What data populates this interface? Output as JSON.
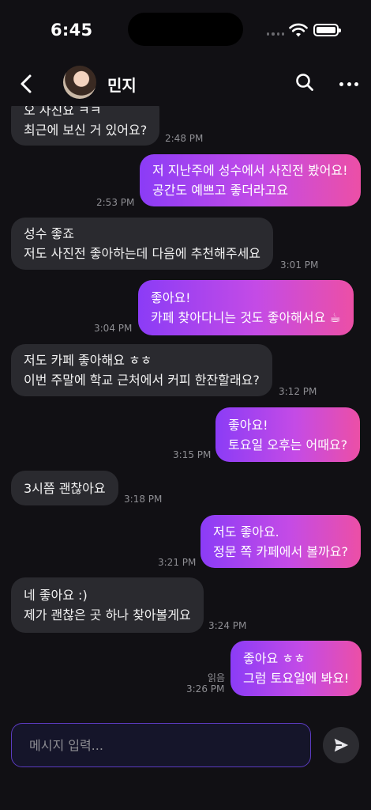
{
  "status_bar": {
    "time": "6:45"
  },
  "header": {
    "contact_name": "민지"
  },
  "messages": [
    {
      "direction": "in",
      "lines": [
        "오 사진요 ㅋㅋ",
        "최근에 보신 거 있어요?"
      ],
      "time": "2:48 PM"
    },
    {
      "direction": "out",
      "lines": [
        "저 지난주에 성수에서 사진전 봤어요!",
        "공간도 예쁘고 좋더라고요"
      ],
      "time": "2:53 PM"
    },
    {
      "direction": "in",
      "lines": [
        "성수 좋죠",
        "저도 사진전 좋아하는데 다음에 추천해주세요"
      ],
      "time": "3:01 PM"
    },
    {
      "direction": "out",
      "lines": [
        "좋아요!",
        "카페 찾아다니는 것도 좋아해서요 ☕"
      ],
      "time": "3:04 PM"
    },
    {
      "direction": "in",
      "lines": [
        "저도 카페 좋아해요 ㅎㅎ",
        "이번 주말에 학교 근처에서 커피 한잔할래요?"
      ],
      "time": "3:12 PM"
    },
    {
      "direction": "out",
      "lines": [
        "좋아요!",
        "토요일 오후는 어때요?"
      ],
      "time": "3:15 PM"
    },
    {
      "direction": "in",
      "lines": [
        "3시쯤 괜찮아요"
      ],
      "time": "3:18 PM"
    },
    {
      "direction": "out",
      "lines": [
        "저도 좋아요.",
        "정문 쪽 카페에서 볼까요?"
      ],
      "time": "3:21 PM"
    },
    {
      "direction": "in",
      "lines": [
        "네 좋아요 :)",
        "제가 괜찮은 곳 하나 찾아볼게요"
      ],
      "time": "3:24 PM"
    },
    {
      "direction": "out",
      "lines": [
        "좋아요 ㅎㅎ",
        "그럼 토요일에 봐요!"
      ],
      "time": "3:26 PM",
      "read_label": "읽음"
    }
  ],
  "composer": {
    "placeholder": "메시지 입력..."
  },
  "icons": {
    "back": "chevron-left-icon",
    "search": "search-icon",
    "more": "more-dots-icon",
    "send": "send-icon",
    "wifi": "wifi-icon",
    "battery": "battery-icon"
  },
  "colors": {
    "background": "#111014",
    "incoming_bubble": "#2a2a2f",
    "outgoing_gradient_start": "#8b3cf6",
    "outgoing_gradient_end": "#ec4fa6",
    "input_border": "#5b3bbf"
  }
}
